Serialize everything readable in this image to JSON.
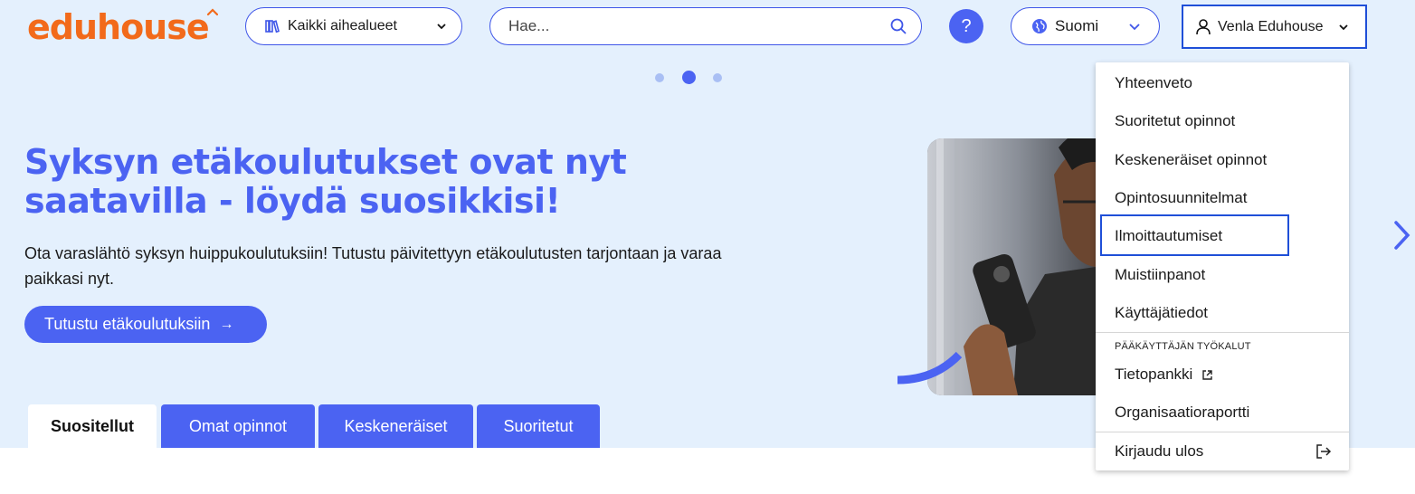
{
  "header": {
    "logo_text": "eduhouse",
    "category_label": "Kaikki aihealueet",
    "search_placeholder": "Hae...",
    "help_label": "?",
    "language_label": "Suomi",
    "user_name": "Venla Eduhouse"
  },
  "hero": {
    "title": "Syksyn etäkoulutukset ovat nyt saatavilla - löydä suosikkisi!",
    "description": "Ota varaslähtö syksyn huippukoulutuksiin! Tutustu päivitettyyn etäkoulutusten tarjontaan ja varaa paikkasi nyt.",
    "cta_label": "Tutustu etäkoulutuksiin",
    "cta_arrow": "→"
  },
  "tabs": [
    {
      "label": "Suositellut"
    },
    {
      "label": "Omat opinnot"
    },
    {
      "label": "Keskeneräiset"
    },
    {
      "label": "Suoritetut"
    }
  ],
  "user_menu": {
    "items": [
      "Yhteenveto",
      "Suoritetut opinnot",
      "Keskeneräiset opinnot",
      "Opintosuunnitelmat",
      "Ilmoittautumiset",
      "Muistiinpanot",
      "Käyttäjätiedot"
    ],
    "admin_heading": "PÄÄKÄYTTÄJÄN TYÖKALUT",
    "admin_items": [
      "Tietopankki",
      "Organisaatioraportti"
    ],
    "logout_label": "Kirjaudu ulos"
  },
  "colors": {
    "brand_orange": "#f26a1b",
    "accent_blue": "#4b63f2",
    "hero_background": "#e4f0fd"
  }
}
